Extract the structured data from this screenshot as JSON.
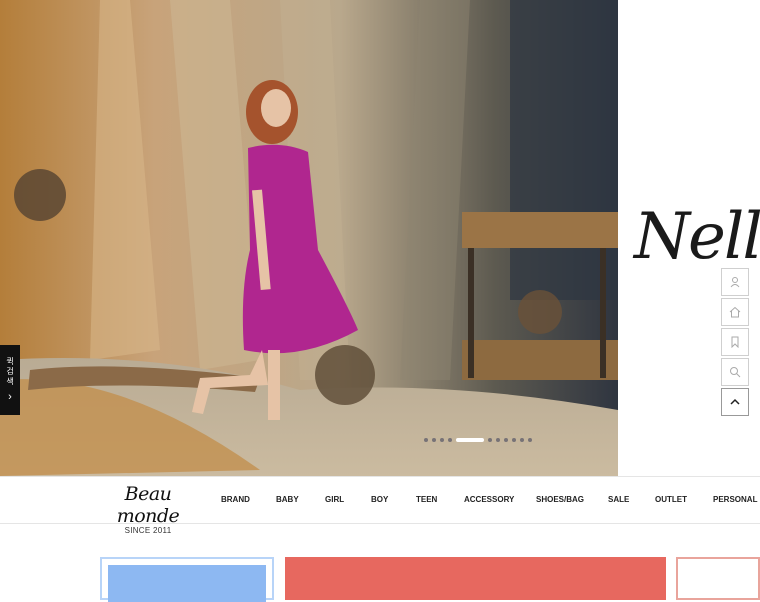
{
  "hero": {
    "script_word": "Nell",
    "slider_dots": 11,
    "active_dot": 4
  },
  "quick_tab": {
    "label": "퀵검색",
    "arrow": "›"
  },
  "quick_menu": {
    "items": [
      {
        "icon": "user-icon"
      },
      {
        "icon": "home-icon"
      },
      {
        "icon": "bookmark-icon"
      },
      {
        "icon": "search-icon"
      },
      {
        "icon": "chevron-up-icon"
      }
    ]
  },
  "logo": {
    "name": "Beau monde",
    "since": "SINCE 2011"
  },
  "nav": {
    "items": [
      "BRAND",
      "BABY",
      "GIRL",
      "BOY",
      "TEEN",
      "ACCESSORY",
      "SHOES/BAG",
      "SALE",
      "OUTLET",
      "PERSONAL"
    ]
  },
  "colors": {
    "card1": "#8db8f2",
    "card2": "#e7685f",
    "card3": "#e9a49c"
  }
}
